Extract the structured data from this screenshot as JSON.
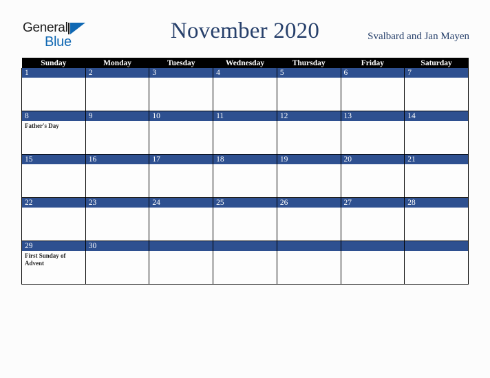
{
  "brand": {
    "name_part1": "General",
    "name_part2": "Blue",
    "triangle_color": "#1068b3",
    "text_color": "#1a1a1a"
  },
  "header": {
    "title": "November 2020",
    "location": "Svalbard and Jan Mayen",
    "title_color": "#27406b"
  },
  "calendar": {
    "month": "November",
    "year": "2020",
    "weekday_headers": [
      "Sunday",
      "Monday",
      "Tuesday",
      "Wednesday",
      "Thursday",
      "Friday",
      "Saturday"
    ],
    "header_bg": "#000000",
    "header_text_color": "#ffffff",
    "daynum_bg": "#2e5090",
    "daynum_text_color": "#ffffff",
    "cell_bg": "#fdfdfd",
    "border_color": "#000000",
    "weeks": [
      [
        {
          "day": "1",
          "events": []
        },
        {
          "day": "2",
          "events": []
        },
        {
          "day": "3",
          "events": []
        },
        {
          "day": "4",
          "events": []
        },
        {
          "day": "5",
          "events": []
        },
        {
          "day": "6",
          "events": []
        },
        {
          "day": "7",
          "events": []
        }
      ],
      [
        {
          "day": "8",
          "events": [
            "Father's Day"
          ]
        },
        {
          "day": "9",
          "events": []
        },
        {
          "day": "10",
          "events": []
        },
        {
          "day": "11",
          "events": []
        },
        {
          "day": "12",
          "events": []
        },
        {
          "day": "13",
          "events": []
        },
        {
          "day": "14",
          "events": []
        }
      ],
      [
        {
          "day": "15",
          "events": []
        },
        {
          "day": "16",
          "events": []
        },
        {
          "day": "17",
          "events": []
        },
        {
          "day": "18",
          "events": []
        },
        {
          "day": "19",
          "events": []
        },
        {
          "day": "20",
          "events": []
        },
        {
          "day": "21",
          "events": []
        }
      ],
      [
        {
          "day": "22",
          "events": []
        },
        {
          "day": "23",
          "events": []
        },
        {
          "day": "24",
          "events": []
        },
        {
          "day": "25",
          "events": []
        },
        {
          "day": "26",
          "events": []
        },
        {
          "day": "27",
          "events": []
        },
        {
          "day": "28",
          "events": []
        }
      ],
      [
        {
          "day": "29",
          "events": [
            "First Sunday of Advent"
          ]
        },
        {
          "day": "30",
          "events": []
        },
        {
          "day": "",
          "events": []
        },
        {
          "day": "",
          "events": []
        },
        {
          "day": "",
          "events": []
        },
        {
          "day": "",
          "events": []
        },
        {
          "day": "",
          "events": []
        }
      ]
    ]
  }
}
